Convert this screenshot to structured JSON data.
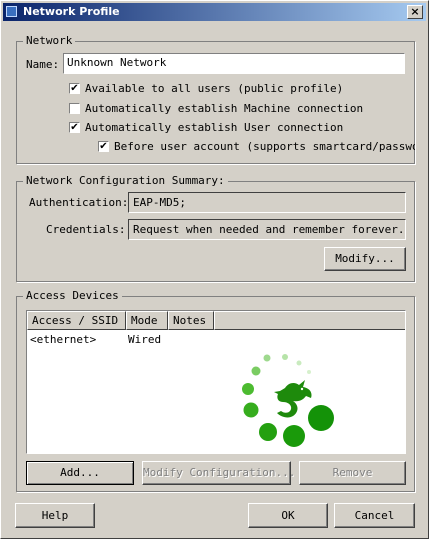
{
  "window": {
    "title": "Network Profile",
    "close_glyph": "×"
  },
  "network_group": {
    "legend": "Network",
    "name_label": "Name:",
    "name_value": "Unknown Network",
    "options": [
      {
        "label": "Available to all users (public profile)",
        "checked": true
      },
      {
        "label": "Automatically establish Machine connection",
        "checked": false
      },
      {
        "label": "Automatically establish User connection",
        "checked": true
      },
      {
        "label": "Before user account (supports smartcard/password on",
        "checked": true
      }
    ]
  },
  "summary_group": {
    "legend": "Network Configuration Summary:",
    "auth_label": "Authentication:",
    "auth_value": "EAP-MD5;",
    "cred_label": "Credentials:",
    "cred_value": "Request when needed and remember forever.",
    "modify_button": "Modify..."
  },
  "devices_group": {
    "legend": "Access Devices",
    "columns": [
      "Access / SSID",
      "Mode",
      "Notes"
    ],
    "rows": [
      {
        "ssid": "<ethernet>",
        "mode": "Wired",
        "notes": ""
      }
    ],
    "add_button": "Add...",
    "modify_config_button": "Modify Configuration...",
    "remove_button": "Remove"
  },
  "footer": {
    "help_button": "Help",
    "ok_button": "OK",
    "cancel_button": "Cancel"
  },
  "colors": {
    "title_start": "#0a246a",
    "title_end": "#a6caf0",
    "face": "#d4d0c8",
    "dragon_green": "#1a9a0a"
  },
  "icons": {
    "logo": "dragon-logo-icon",
    "check": "check-icon"
  }
}
